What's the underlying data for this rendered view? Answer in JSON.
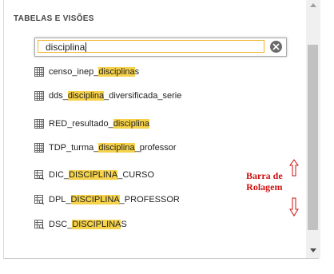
{
  "header": {
    "title": "TABELAS E VISÕES"
  },
  "search": {
    "value": "disciplina",
    "clear_icon": "clear-circle-icon"
  },
  "items": [
    {
      "icon": "table-icon",
      "pre": "censo_inep_",
      "match": "disciplina",
      "post": "s"
    },
    {
      "icon": "table-icon",
      "pre": "dds_",
      "match": "disciplina",
      "post": "_diversificada_serie"
    },
    {
      "icon": "table-icon",
      "pre": "RED_resultado_",
      "match": "disciplina",
      "post": ""
    },
    {
      "icon": "table-icon",
      "pre": "TDP_turma_",
      "match": "disciplina",
      "post": "_professor"
    },
    {
      "icon": "view-icon",
      "pre": "DIC_",
      "match": "DISCIPLINA",
      "post": "_CURSO"
    },
    {
      "icon": "view-icon",
      "pre": "DPL_",
      "match": "DISCIPLINA",
      "post": "_PROFESSOR"
    },
    {
      "icon": "view-icon",
      "pre": "DSC_",
      "match": "DISCIPLINA",
      "post": "S"
    }
  ],
  "annotation": {
    "line1": "Barra de",
    "line2": "Rolagem",
    "color": "#d01010"
  },
  "colors": {
    "highlight": "#f6d24a",
    "search_focus": "#f0b429"
  }
}
